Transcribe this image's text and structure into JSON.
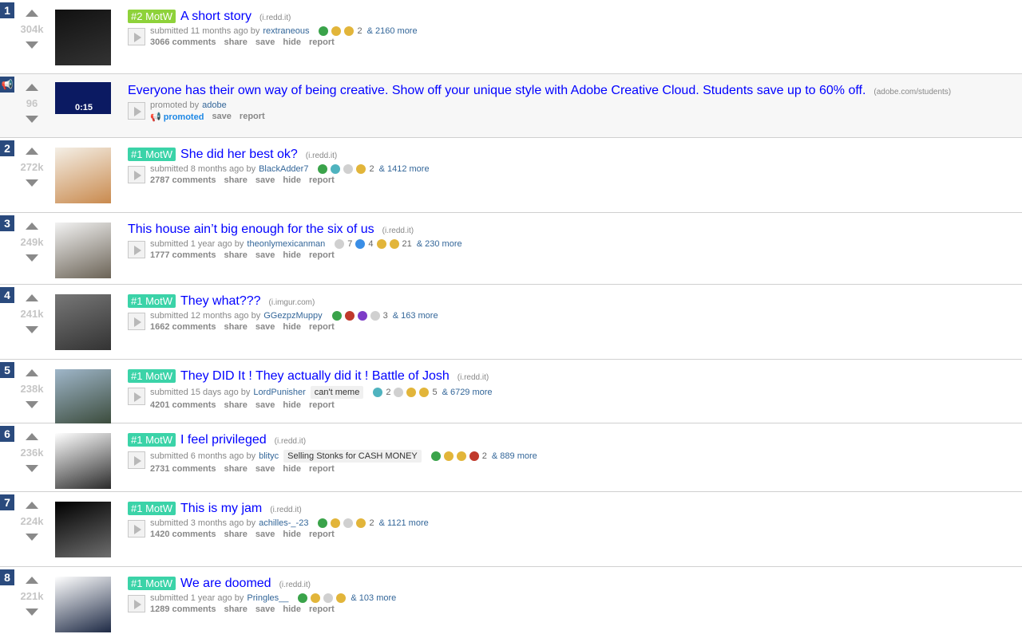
{
  "posts": [
    {
      "rank": "1",
      "score": "304k",
      "flair": "#2 MotW",
      "flair_variant": "two",
      "title": "A short story",
      "domain": "(i.redd.it)",
      "submitted": "submitted 11 months ago by",
      "author": "rextraneous",
      "user_flair": "",
      "awards": [
        "green",
        "gold",
        "gold"
      ],
      "award_count": "2",
      "more_awards": "& 2160 more",
      "comments": "3066 comments",
      "thumb_colors": [
        "#111",
        "#333"
      ]
    },
    {
      "rank": "",
      "score": "96",
      "promoted": true,
      "title": "Everyone has their own way of being creative. Show off your unique style with Adobe Creative Cloud. Students save up to 60% off.",
      "domain": "(adobe.com/students)",
      "submitted": "promoted by",
      "author": "adobe",
      "promoted_label": "promoted",
      "thumb_time": "0:15"
    },
    {
      "rank": "2",
      "score": "272k",
      "flair": "#1 MotW",
      "title": "She did her best ok?",
      "domain": "(i.redd.it)",
      "submitted": "submitted 8 months ago by",
      "author": "BlackAdder7",
      "user_flair": "",
      "awards": [
        "green",
        "teal",
        "white",
        "gold"
      ],
      "award_count": "2",
      "more_awards": "& 1412 more",
      "comments": "2787 comments",
      "thumb_colors": [
        "#f4efe6",
        "#c98a4e"
      ]
    },
    {
      "rank": "3",
      "score": "249k",
      "flair": "",
      "title": "This house ain’t big enough for the six of us",
      "domain": "(i.redd.it)",
      "submitted": "submitted 1 year ago by",
      "author": "theonlymexicanman",
      "user_flair": "",
      "awards": [
        "white",
        "blue",
        "gold",
        "gold"
      ],
      "award_count": "21",
      "extra_counts": [
        "7",
        "4"
      ],
      "more_awards": "& 230 more",
      "comments": "1777 comments",
      "thumb_colors": [
        "#f2f2f2",
        "#6b6356"
      ]
    },
    {
      "rank": "4",
      "score": "241k",
      "flair": "#1 MotW",
      "title": "They what???",
      "domain": "(i.imgur.com)",
      "submitted": "submitted 12 months ago by",
      "author": "GGezpzMuppy",
      "user_flair": "",
      "awards": [
        "green",
        "red",
        "purple",
        "white"
      ],
      "award_count": "3",
      "more_awards": "& 163 more",
      "comments": "1662 comments",
      "thumb_colors": [
        "#777",
        "#333"
      ]
    },
    {
      "rank": "5",
      "score": "238k",
      "flair": "#1 MotW",
      "title": "They DID It ! They actually did it ! Battle of Josh",
      "domain": "(i.redd.it)",
      "submitted": "submitted 15 days ago by",
      "author": "LordPunisher",
      "user_flair": "can't meme",
      "awards": [
        "teal",
        "white",
        "gold",
        "gold"
      ],
      "award_count": "5",
      "extra_counts": [
        "2"
      ],
      "more_awards": "& 6729 more",
      "comments": "4201 comments",
      "thumb_colors": [
        "#9fb6c9",
        "#3a4a3a"
      ]
    },
    {
      "rank": "6",
      "score": "236k",
      "flair": "#1 MotW",
      "title": "I feel privileged",
      "domain": "(i.redd.it)",
      "submitted": "submitted 6 months ago by",
      "author": "blityc",
      "user_flair": "Selling Stonks for CASH MONEY",
      "awards": [
        "green",
        "gold",
        "gold",
        "red"
      ],
      "award_count": "2",
      "more_awards": "& 889 more",
      "comments": "2731 comments",
      "thumb_colors": [
        "#fff",
        "#2b2b2b"
      ]
    },
    {
      "rank": "7",
      "score": "224k",
      "flair": "#1 MotW",
      "title": "This is my jam",
      "domain": "(i.redd.it)",
      "submitted": "submitted 3 months ago by",
      "author": "achilles-_-23",
      "user_flair": "",
      "awards": [
        "green",
        "gold",
        "white",
        "gold"
      ],
      "award_count": "2",
      "more_awards": "& 1121 more",
      "comments": "1420 comments",
      "thumb_colors": [
        "#000",
        "#6d6d6d"
      ]
    },
    {
      "rank": "8",
      "score": "221k",
      "flair": "#1 MotW",
      "title": "We are doomed",
      "domain": "(i.redd.it)",
      "submitted": "submitted 1 year ago by",
      "author": "Pringles__",
      "user_flair": "",
      "awards": [
        "green",
        "gold",
        "white",
        "gold"
      ],
      "award_count": "",
      "more_awards": "& 103 more",
      "comments": "1289 comments",
      "thumb_colors": [
        "#fff",
        "#1e2a45"
      ]
    }
  ],
  "actions": {
    "share": "share",
    "save": "save",
    "hide": "hide",
    "report": "report"
  },
  "award_colors": {
    "green": "#3aa34a",
    "gold": "#e2b53a",
    "teal": "#4fb3bf",
    "white": "#d0d0d0",
    "red": "#c0392b",
    "purple": "#7d3cc8",
    "blue": "#3a8ee6"
  },
  "accent": {
    "rank_bg": "#2a4a7d",
    "flair_one": "#3bd3a8",
    "flair_two": "#8ed23a",
    "title": "#0000ff"
  }
}
